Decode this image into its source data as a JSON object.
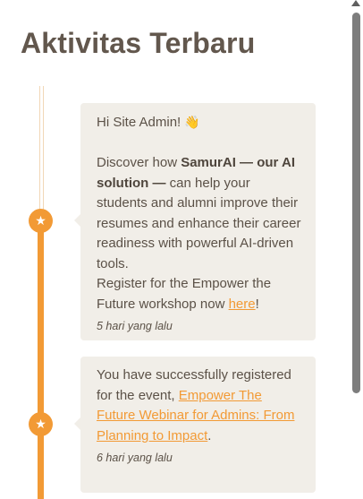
{
  "header": {
    "title": "Aktivitas Terbaru"
  },
  "activities": [
    {
      "greeting": "Hi Site Admin!",
      "greeting_emoji": "👋",
      "p1_pre": "Discover how ",
      "p1_bold": "SamurAI — our AI solution —",
      "p1_post": " can help your students and alumni improve their resumes and enhance their career readiness with powerful AI-driven tools.",
      "p2_pre": "Register for the Empower the Future workshop now ",
      "p2_link": "here",
      "p2_post": "!",
      "time": "5 hari yang lalu"
    },
    {
      "text_pre": "You have successfully registered for the event, ",
      "link": "Empower The Future Webinar for Admins: From Planning to Impact",
      "text_post": ".",
      "time": "6 hari yang lalu"
    }
  ],
  "icons": {
    "timeline_marker": "star-icon",
    "marker_glyph": "★"
  },
  "colors": {
    "accent": "#f29a35",
    "card_bg": "#f1eee8",
    "text": "#5b5147"
  }
}
